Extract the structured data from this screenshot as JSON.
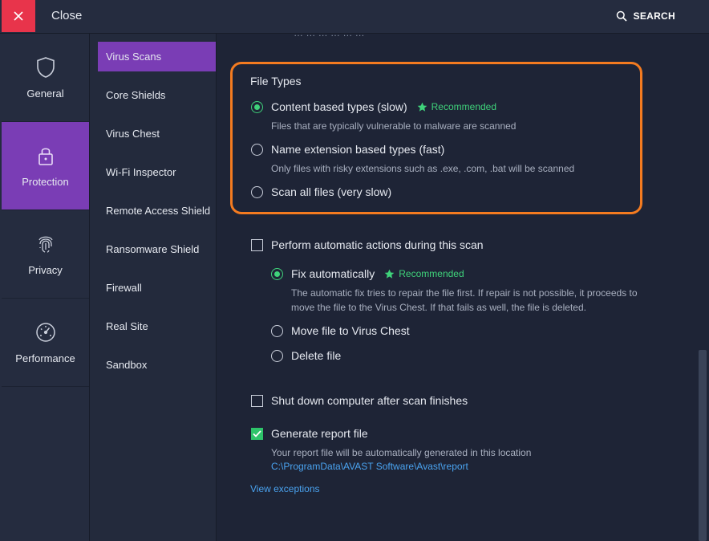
{
  "topbar": {
    "close_label": "Close",
    "search_label": "SEARCH"
  },
  "leftnav": [
    {
      "label": "General",
      "icon": "shield-icon",
      "active": false
    },
    {
      "label": "Protection",
      "icon": "lock-icon",
      "active": true
    },
    {
      "label": "Privacy",
      "icon": "fingerprint-icon",
      "active": false
    },
    {
      "label": "Performance",
      "icon": "gauge-icon",
      "active": false
    }
  ],
  "subnav": [
    "Virus Scans",
    "Core Shields",
    "Virus Chest",
    "Wi-Fi Inspector",
    "Remote Access Shield",
    "Ransomware Shield",
    "Firewall",
    "Real Site",
    "Sandbox"
  ],
  "content": {
    "cutoff_text": "… … … … … …",
    "file_types": {
      "title": "File Types",
      "content_based": "Content based types (slow)",
      "content_based_desc": "Files that are typically vulnerable to malware are scanned",
      "name_extension": "Name extension based types (fast)",
      "name_extension_desc": "Only files with risky extensions such as .exe, .com, .bat will be scanned",
      "scan_all": "Scan all files (very slow)"
    },
    "recommended": "Recommended",
    "auto_actions": {
      "label": "Perform automatic actions during this scan",
      "fix": "Fix automatically",
      "fix_desc_1": "The automatic fix tries to repair the file first. If repair is not possible, it proceeds to",
      "fix_desc_2": "move the file to the Virus Chest. If that fails as well, the file is deleted.",
      "move": "Move file to Virus Chest",
      "delete": "Delete file"
    },
    "shutdown": "Shut down computer after scan finishes",
    "report": {
      "label": "Generate report file",
      "desc": "Your report file will be automatically generated in this location",
      "path": "C:\\ProgramData\\AVAST Software\\Avast\\report"
    },
    "view_exceptions": "View exceptions"
  },
  "colors": {
    "accent_purple": "#7a3db5",
    "close_red": "#e8344b",
    "highlight_orange": "#f47b20",
    "green": "#3fd27a",
    "link_blue": "#4aa3f0"
  }
}
